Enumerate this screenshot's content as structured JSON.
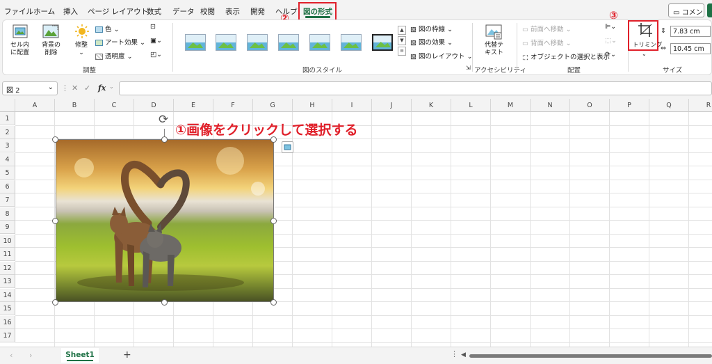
{
  "tabs": [
    {
      "label": "ファイル"
    },
    {
      "label": "ホーム"
    },
    {
      "label": "挿入"
    },
    {
      "label": "ページ レイアウト"
    },
    {
      "label": "数式"
    },
    {
      "label": "データ"
    },
    {
      "label": "校閲"
    },
    {
      "label": "表示"
    },
    {
      "label": "開発"
    },
    {
      "label": "ヘルプ"
    },
    {
      "label": "図の形式",
      "active": true
    }
  ],
  "header_buttons": {
    "comment": "コメント"
  },
  "annotations": {
    "step1": "①画像をクリックして選択する",
    "step2": "②",
    "step3": "③"
  },
  "ribbon": {
    "adjust": {
      "group_label": "調整",
      "cell_fit_label_1": "セル内",
      "cell_fit_label_2": "に配置",
      "remove_bg_label_1": "背景の",
      "remove_bg_label_2": "削除",
      "corrections_label": "修整",
      "color_label": "色",
      "artistic_label": "アート効果",
      "transparency_label": "透明度"
    },
    "styles": {
      "group_label": "図のスタイル",
      "border_label": "図の枠線",
      "effects_label": "図の効果",
      "layout_label": "図のレイアウト"
    },
    "accessibility": {
      "group_label": "アクセシビリティ",
      "alt_text_label_1": "代替テ",
      "alt_text_label_2": "キスト"
    },
    "arrange": {
      "group_label": "配置",
      "bring_forward": "前面へ移動",
      "send_backward": "背面へ移動",
      "selection_pane": "オブジェクトの選択と表示"
    },
    "size": {
      "group_label": "サイズ",
      "crop_label": "トリミング",
      "height_value": "7.83 cm",
      "width_value": "10.45 cm"
    }
  },
  "formula_bar": {
    "name_box": "図 2",
    "fx": "fx",
    "formula": ""
  },
  "grid": {
    "columns": [
      "A",
      "B",
      "C",
      "D",
      "E",
      "F",
      "G",
      "H",
      "I",
      "J",
      "K",
      "L",
      "M",
      "N",
      "O",
      "P",
      "Q",
      "R"
    ],
    "rows": [
      "1",
      "2",
      "3",
      "4",
      "5",
      "6",
      "7",
      "8",
      "9",
      "10",
      "11",
      "12",
      "13",
      "14",
      "15",
      "16",
      "17"
    ]
  },
  "sheets": [
    {
      "name": "Sheet1",
      "active": true
    }
  ],
  "colors": {
    "accent": "#1e7145",
    "annotation": "#e0202a"
  }
}
